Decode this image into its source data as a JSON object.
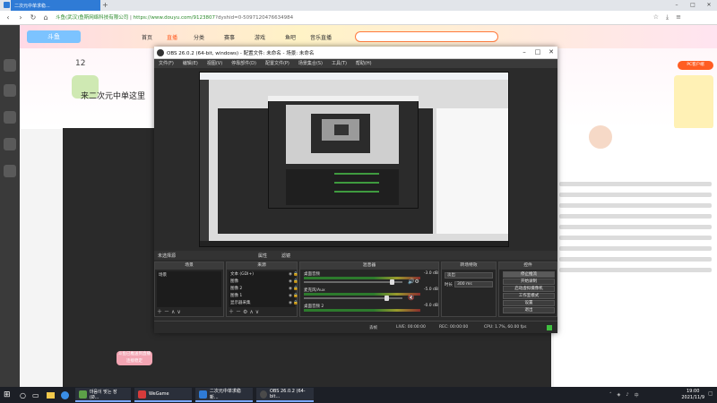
{
  "browser": {
    "active_tab": "二次元中单求稳...",
    "tab2": "",
    "url_secure_label": "斗鱼(武汉)鱼斯网络科技有限公司",
    "url": "https://www.douyu.com/9123807",
    "url_rest": "?dyshid=0-5097120476634984"
  },
  "douyu": {
    "logo": "斗鱼",
    "nav": [
      "首页",
      "直播",
      "分类",
      "赛事",
      "游戏",
      "鱼吧",
      "音乐直播"
    ],
    "room_title": "来二次元中单这里",
    "hot_label": "PC客户端",
    "streamer_name": "",
    "followers": "12"
  },
  "obs": {
    "title": "OBS 26.0.2 (64-bit, windows) - 配置文件: 未命名 - 场景: 未命名",
    "menu": [
      "文件(F)",
      "编辑(E)",
      "视图(V)",
      "停靠部件(D)",
      "配置文件(P)",
      "场景集合(S)",
      "工具(T)",
      "帮助(H)"
    ],
    "source_bar": {
      "selected": "未选择源",
      "props": "属性",
      "filters": "滤镜"
    },
    "docks": {
      "scenes": "场景",
      "sources": "来源",
      "mixer": "混音器",
      "transitions": "转场特效",
      "controls": "控件"
    },
    "scene_items": [
      "场景"
    ],
    "source_items": [
      "文本 (GDI+)",
      "图像",
      "图像 2",
      "图像 1",
      "显示器采集"
    ],
    "mixer": [
      {
        "name": "桌面音频",
        "db": "-3.0 dB"
      },
      {
        "name": "麦克风/Aux",
        "db": "-5.0 dB"
      },
      {
        "name": "桌面音频 2",
        "db": "-0.0 dB"
      }
    ],
    "transition": {
      "type": "淡出",
      "duration_label": "时长",
      "duration": "300 ms"
    },
    "controls": [
      "停止推流",
      "开始录制",
      "启动虚拟摄像机",
      "工作室模式",
      "设置",
      "退出"
    ],
    "status": {
      "live": "LIVE: 00:00:00",
      "rec": "REC: 00:00:00",
      "cpu": "CPU: 1.7%, 60.00 fps",
      "drop": "丢帧"
    }
  },
  "taskbar": {
    "items": [
      {
        "label": "마음이 맞는 장 (Ø...",
        "color": "#5da048"
      },
      {
        "label": "WeGame",
        "color": "#d63b3b"
      },
      {
        "label": "二次元中单求稳新...",
        "color": "#2f7bd6"
      },
      {
        "label": "OBS 26.0.2 (64-bit...",
        "color": "#4a4a4a"
      }
    ],
    "time": "19:00",
    "date": "2021/11/9",
    "lang": "中"
  },
  "popup": {
    "text": "斗鱼已推送到直播 \n 连接稳定"
  }
}
